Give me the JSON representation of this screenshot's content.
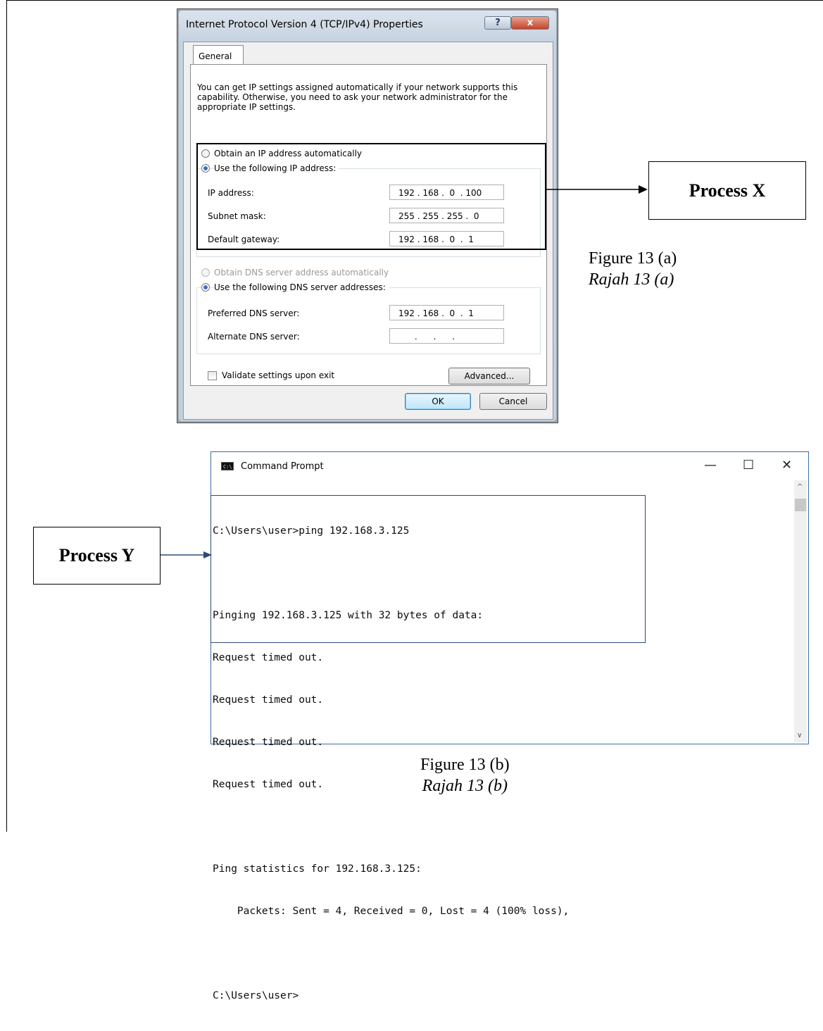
{
  "dialog": {
    "title": "Internet Protocol Version 4 (TCP/IPv4) Properties",
    "help_glyph": "?",
    "close_glyph": "x",
    "tab_general": "General",
    "description": "You can get IP settings assigned automatically if your network supports this capability. Otherwise, you need to ask your network administrator for the appropriate IP settings.",
    "radio_auto_ip": "Obtain an IP address automatically",
    "radio_static_ip": "Use the following IP address:",
    "ip_address_label": "IP address:",
    "ip_address_value": "192 . 168 .  0  . 100",
    "subnet_label": "Subnet mask:",
    "subnet_value": "255 . 255 . 255 .  0",
    "gateway_label": "Default gateway:",
    "gateway_value": "192 . 168 .  0  .  1",
    "radio_auto_dns": "Obtain DNS server address automatically",
    "radio_static_dns": "Use the following DNS server addresses:",
    "preferred_dns_label": "Preferred DNS server:",
    "preferred_dns_value": "192 . 168 .  0  .  1",
    "alternate_dns_label": "Alternate DNS server:",
    "alternate_dns_value": "      .      .      .",
    "validate_label": "Validate settings upon exit",
    "advanced_button": "Advanced...",
    "ok_button": "OK",
    "cancel_button": "Cancel"
  },
  "annotations": {
    "process_x": "Process X",
    "process_y": "Process Y",
    "fig_a_en": "Figure 13 (a)",
    "fig_a_ms": "Rajah 13 (a)",
    "fig_b_en": "Figure 13 (b)",
    "fig_b_ms": "Rajah 13 (b)"
  },
  "cmd": {
    "title": "Command Prompt",
    "icon_text": "C:\\",
    "minimize_glyph": "—",
    "maximize_glyph": "☐",
    "close_glyph": "✕",
    "lines": [
      "C:\\Users\\user>ping 192.168.3.125",
      "",
      "Pinging 192.168.3.125 with 32 bytes of data:",
      "Request timed out.",
      "Request timed out.",
      "Request timed out.",
      "Request timed out.",
      "",
      "Ping statistics for 192.168.3.125:",
      "    Packets: Sent = 4, Received = 0, Lost = 4 (100% loss),",
      "",
      "C:\\Users\\user>"
    ]
  }
}
